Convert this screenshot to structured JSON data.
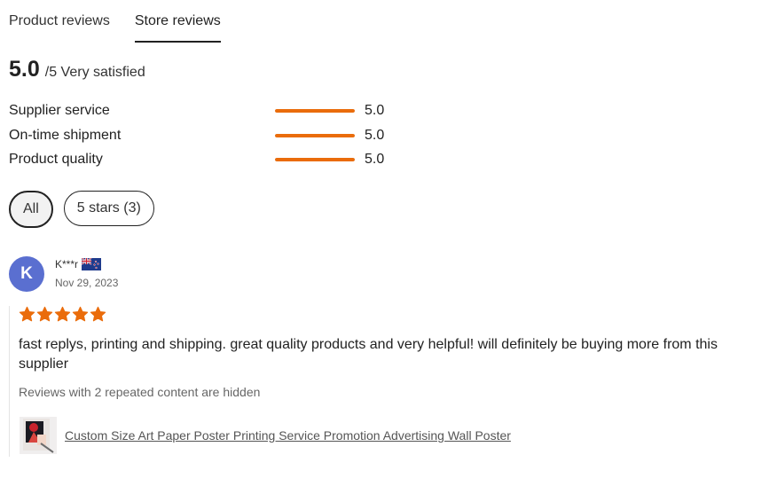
{
  "tabs": [
    {
      "label": "Product reviews",
      "active": false
    },
    {
      "label": "Store reviews",
      "active": true
    }
  ],
  "summary": {
    "score": "5.0",
    "suffix": "/5 Very satisfied"
  },
  "ratings": [
    {
      "label": "Supplier service",
      "value": "5.0",
      "fill_fraction": 1.0
    },
    {
      "label": "On-time shipment",
      "value": "5.0",
      "fill_fraction": 1.0
    },
    {
      "label": "Product quality",
      "value": "5.0",
      "fill_fraction": 1.0
    }
  ],
  "filters": [
    {
      "label": "All",
      "selected": true
    },
    {
      "label": "5 stars (3)",
      "selected": false
    }
  ],
  "review": {
    "avatar_letter": "K",
    "avatar_color": "#5a6fd0",
    "reviewer": "K***r",
    "flag_icon": "new-zealand-flag-icon",
    "date": "Nov 29, 2023",
    "stars": 5,
    "star_color": "#ea6c0b",
    "text": "fast replys, printing and shipping. great quality products and very helpful! will definitely be buying more from this supplier",
    "hidden_note": "Reviews with 2 repeated content are hidden",
    "product_link": "Custom Size Art Paper Poster Printing Service Promotion Advertising Wall Poster"
  },
  "colors": {
    "accent": "#ea6c0b",
    "bar_track": "#e8e8e8"
  }
}
